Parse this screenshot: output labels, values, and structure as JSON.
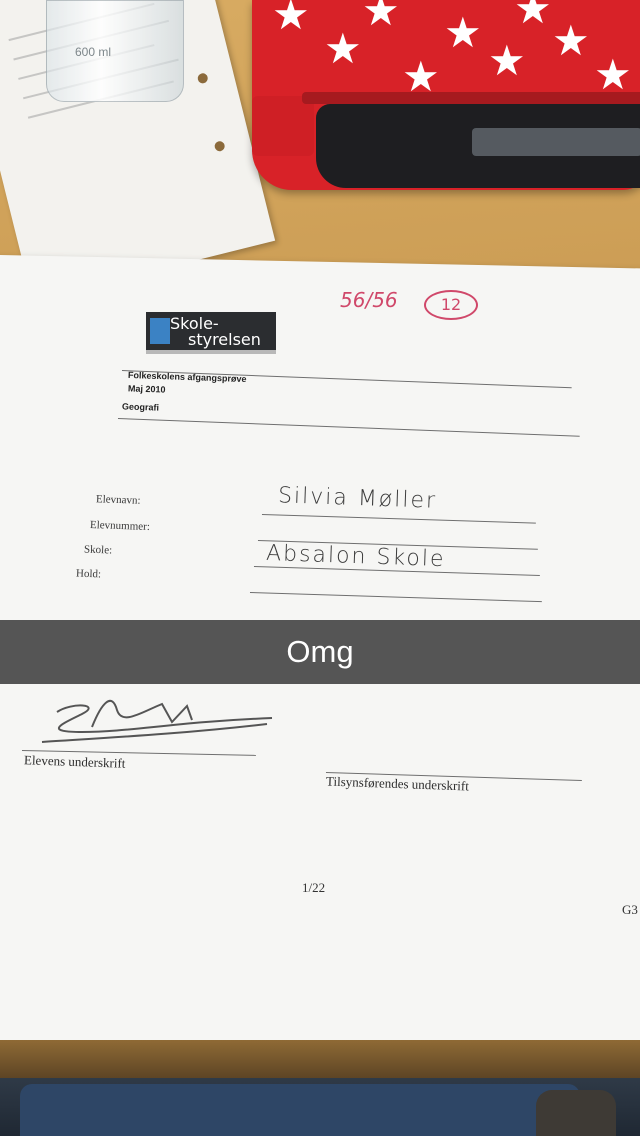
{
  "bottle": {
    "label": "600 ml"
  },
  "document": {
    "grade_score": "56/56",
    "grade_mark": "12",
    "logo_line1": "Skole-",
    "logo_line2": "styrelsen",
    "title": "Folkeskolens afgangsprøve",
    "date": "Maj 2010",
    "subject": "Geografi",
    "fields": [
      {
        "label": "Elevnavn:",
        "value": "Silvia Møller"
      },
      {
        "label": "Elevnummer:",
        "value": ""
      },
      {
        "label": "Skole:",
        "value": "Absalon Skole"
      },
      {
        "label": "Hold:",
        "value": ""
      }
    ],
    "student_signature_label": "Elevens underskrift",
    "supervisor_signature_label": "Tilsynsførendes underskrift",
    "page_number": "1/22",
    "code": "G3"
  },
  "caption": {
    "text": "Omg"
  },
  "colors": {
    "pencil_case": "#d82228",
    "grade_ink": "#d0486a",
    "desk": "#c99a52"
  }
}
